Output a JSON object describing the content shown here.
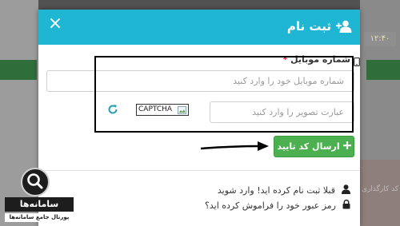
{
  "background": {
    "clock": "۱۲:۴۰",
    "bg_text": "کد کارگذاری"
  },
  "modal": {
    "title": "ثبت نام",
    "close_label": "×",
    "header_color": "#1fb6d3"
  },
  "form": {
    "mobile_label": "شماره موبایل",
    "required_mark": "*",
    "mobile_placeholder": "شماره موبایل خود را وارد کنید",
    "captcha_placeholder": "عبارت تصویر را وارد کنید",
    "captcha_alt": "CAPTCHA",
    "submit_label": "ارسال کد تایید",
    "submit_color": "#4cb050"
  },
  "links": {
    "login": "قبلا ثبت نام کرده اید! وارد شوید",
    "forgot": "رمز عبور خود را فراموش کرده اید؟"
  },
  "watermark": {
    "brand": "سامانه‌ها",
    "tagline": "پورتال جامع سامانه‌ها"
  },
  "icons": [
    "user-plus-icon",
    "close-icon",
    "mobile-phone-icon",
    "refresh-icon",
    "broken-image-icon",
    "plus-icon",
    "user-icon",
    "lock-icon",
    "arrow-icon",
    "magnifier-logo-icon"
  ]
}
